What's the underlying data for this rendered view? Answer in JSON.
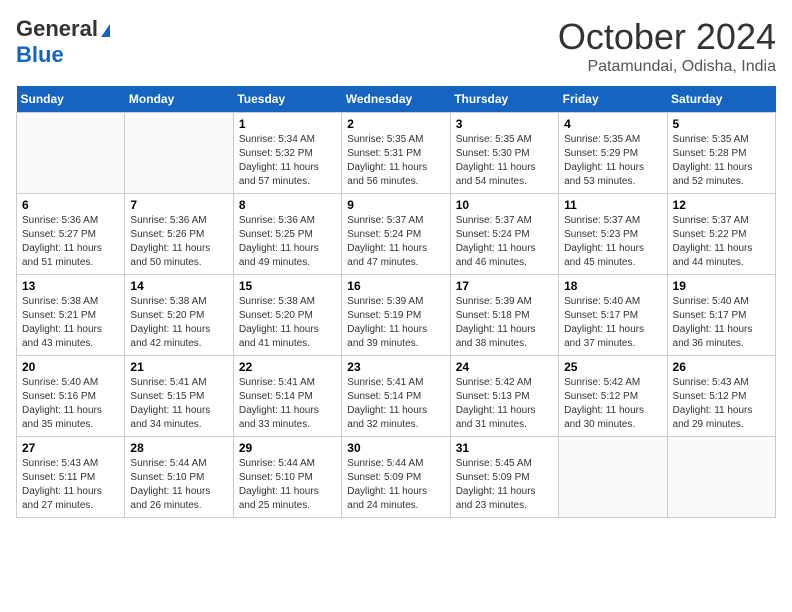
{
  "header": {
    "logo_general": "General",
    "logo_blue": "Blue",
    "month_title": "October 2024",
    "location": "Patamundai, Odisha, India"
  },
  "weekdays": [
    "Sunday",
    "Monday",
    "Tuesday",
    "Wednesday",
    "Thursday",
    "Friday",
    "Saturday"
  ],
  "weeks": [
    [
      {
        "day": "",
        "sunrise": "",
        "sunset": "",
        "daylight": ""
      },
      {
        "day": "",
        "sunrise": "",
        "sunset": "",
        "daylight": ""
      },
      {
        "day": "1",
        "sunrise": "Sunrise: 5:34 AM",
        "sunset": "Sunset: 5:32 PM",
        "daylight": "Daylight: 11 hours and 57 minutes."
      },
      {
        "day": "2",
        "sunrise": "Sunrise: 5:35 AM",
        "sunset": "Sunset: 5:31 PM",
        "daylight": "Daylight: 11 hours and 56 minutes."
      },
      {
        "day": "3",
        "sunrise": "Sunrise: 5:35 AM",
        "sunset": "Sunset: 5:30 PM",
        "daylight": "Daylight: 11 hours and 54 minutes."
      },
      {
        "day": "4",
        "sunrise": "Sunrise: 5:35 AM",
        "sunset": "Sunset: 5:29 PM",
        "daylight": "Daylight: 11 hours and 53 minutes."
      },
      {
        "day": "5",
        "sunrise": "Sunrise: 5:35 AM",
        "sunset": "Sunset: 5:28 PM",
        "daylight": "Daylight: 11 hours and 52 minutes."
      }
    ],
    [
      {
        "day": "6",
        "sunrise": "Sunrise: 5:36 AM",
        "sunset": "Sunset: 5:27 PM",
        "daylight": "Daylight: 11 hours and 51 minutes."
      },
      {
        "day": "7",
        "sunrise": "Sunrise: 5:36 AM",
        "sunset": "Sunset: 5:26 PM",
        "daylight": "Daylight: 11 hours and 50 minutes."
      },
      {
        "day": "8",
        "sunrise": "Sunrise: 5:36 AM",
        "sunset": "Sunset: 5:25 PM",
        "daylight": "Daylight: 11 hours and 49 minutes."
      },
      {
        "day": "9",
        "sunrise": "Sunrise: 5:37 AM",
        "sunset": "Sunset: 5:24 PM",
        "daylight": "Daylight: 11 hours and 47 minutes."
      },
      {
        "day": "10",
        "sunrise": "Sunrise: 5:37 AM",
        "sunset": "Sunset: 5:24 PM",
        "daylight": "Daylight: 11 hours and 46 minutes."
      },
      {
        "day": "11",
        "sunrise": "Sunrise: 5:37 AM",
        "sunset": "Sunset: 5:23 PM",
        "daylight": "Daylight: 11 hours and 45 minutes."
      },
      {
        "day": "12",
        "sunrise": "Sunrise: 5:37 AM",
        "sunset": "Sunset: 5:22 PM",
        "daylight": "Daylight: 11 hours and 44 minutes."
      }
    ],
    [
      {
        "day": "13",
        "sunrise": "Sunrise: 5:38 AM",
        "sunset": "Sunset: 5:21 PM",
        "daylight": "Daylight: 11 hours and 43 minutes."
      },
      {
        "day": "14",
        "sunrise": "Sunrise: 5:38 AM",
        "sunset": "Sunset: 5:20 PM",
        "daylight": "Daylight: 11 hours and 42 minutes."
      },
      {
        "day": "15",
        "sunrise": "Sunrise: 5:38 AM",
        "sunset": "Sunset: 5:20 PM",
        "daylight": "Daylight: 11 hours and 41 minutes."
      },
      {
        "day": "16",
        "sunrise": "Sunrise: 5:39 AM",
        "sunset": "Sunset: 5:19 PM",
        "daylight": "Daylight: 11 hours and 39 minutes."
      },
      {
        "day": "17",
        "sunrise": "Sunrise: 5:39 AM",
        "sunset": "Sunset: 5:18 PM",
        "daylight": "Daylight: 11 hours and 38 minutes."
      },
      {
        "day": "18",
        "sunrise": "Sunrise: 5:40 AM",
        "sunset": "Sunset: 5:17 PM",
        "daylight": "Daylight: 11 hours and 37 minutes."
      },
      {
        "day": "19",
        "sunrise": "Sunrise: 5:40 AM",
        "sunset": "Sunset: 5:17 PM",
        "daylight": "Daylight: 11 hours and 36 minutes."
      }
    ],
    [
      {
        "day": "20",
        "sunrise": "Sunrise: 5:40 AM",
        "sunset": "Sunset: 5:16 PM",
        "daylight": "Daylight: 11 hours and 35 minutes."
      },
      {
        "day": "21",
        "sunrise": "Sunrise: 5:41 AM",
        "sunset": "Sunset: 5:15 PM",
        "daylight": "Daylight: 11 hours and 34 minutes."
      },
      {
        "day": "22",
        "sunrise": "Sunrise: 5:41 AM",
        "sunset": "Sunset: 5:14 PM",
        "daylight": "Daylight: 11 hours and 33 minutes."
      },
      {
        "day": "23",
        "sunrise": "Sunrise: 5:41 AM",
        "sunset": "Sunset: 5:14 PM",
        "daylight": "Daylight: 11 hours and 32 minutes."
      },
      {
        "day": "24",
        "sunrise": "Sunrise: 5:42 AM",
        "sunset": "Sunset: 5:13 PM",
        "daylight": "Daylight: 11 hours and 31 minutes."
      },
      {
        "day": "25",
        "sunrise": "Sunrise: 5:42 AM",
        "sunset": "Sunset: 5:12 PM",
        "daylight": "Daylight: 11 hours and 30 minutes."
      },
      {
        "day": "26",
        "sunrise": "Sunrise: 5:43 AM",
        "sunset": "Sunset: 5:12 PM",
        "daylight": "Daylight: 11 hours and 29 minutes."
      }
    ],
    [
      {
        "day": "27",
        "sunrise": "Sunrise: 5:43 AM",
        "sunset": "Sunset: 5:11 PM",
        "daylight": "Daylight: 11 hours and 27 minutes."
      },
      {
        "day": "28",
        "sunrise": "Sunrise: 5:44 AM",
        "sunset": "Sunset: 5:10 PM",
        "daylight": "Daylight: 11 hours and 26 minutes."
      },
      {
        "day": "29",
        "sunrise": "Sunrise: 5:44 AM",
        "sunset": "Sunset: 5:10 PM",
        "daylight": "Daylight: 11 hours and 25 minutes."
      },
      {
        "day": "30",
        "sunrise": "Sunrise: 5:44 AM",
        "sunset": "Sunset: 5:09 PM",
        "daylight": "Daylight: 11 hours and 24 minutes."
      },
      {
        "day": "31",
        "sunrise": "Sunrise: 5:45 AM",
        "sunset": "Sunset: 5:09 PM",
        "daylight": "Daylight: 11 hours and 23 minutes."
      },
      {
        "day": "",
        "sunrise": "",
        "sunset": "",
        "daylight": ""
      },
      {
        "day": "",
        "sunrise": "",
        "sunset": "",
        "daylight": ""
      }
    ]
  ]
}
